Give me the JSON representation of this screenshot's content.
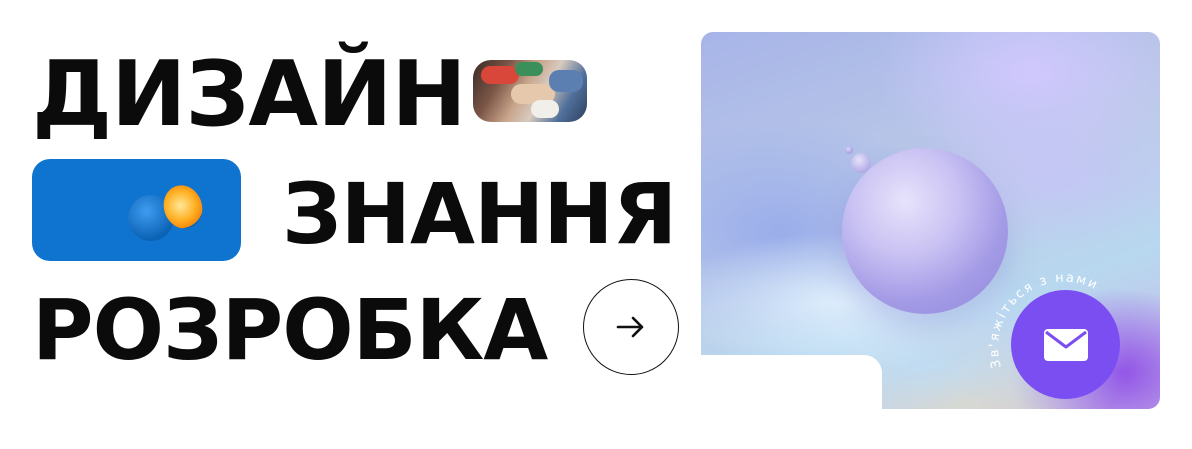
{
  "headline": {
    "line1": "ДИЗАЙН",
    "line2": "ЗНАННЯ",
    "line3": "РОЗРОБКА"
  },
  "images": {
    "hands": "hands-together-photo",
    "orange": "orange-on-blue-photo",
    "hero": "abstract-3d-sphere-gradient"
  },
  "cta": {
    "arrow_icon": "arrow-right-icon"
  },
  "contact": {
    "ring_text": "Зв'яжіться з нами",
    "icon": "mail-icon",
    "color": "#7b4ef2"
  }
}
